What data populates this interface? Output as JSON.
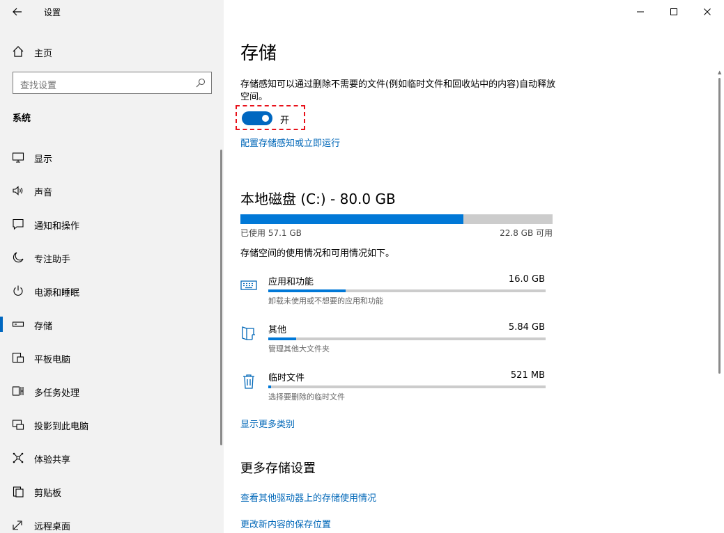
{
  "window": {
    "app_title": "设置"
  },
  "sidebar": {
    "home_label": "主页",
    "search_placeholder": "查找设置",
    "section_label": "系统",
    "items": [
      {
        "label": "显示",
        "icon": "monitor-icon"
      },
      {
        "label": "声音",
        "icon": "speaker-icon"
      },
      {
        "label": "通知和操作",
        "icon": "notification-icon"
      },
      {
        "label": "专注助手",
        "icon": "moon-icon"
      },
      {
        "label": "电源和睡眠",
        "icon": "power-icon"
      },
      {
        "label": "存储",
        "icon": "storage-icon",
        "active": true
      },
      {
        "label": "平板电脑",
        "icon": "tablet-icon"
      },
      {
        "label": "多任务处理",
        "icon": "multitask-icon"
      },
      {
        "label": "投影到此电脑",
        "icon": "project-icon"
      },
      {
        "label": "体验共享",
        "icon": "share-icon"
      },
      {
        "label": "剪贴板",
        "icon": "clipboard-icon"
      },
      {
        "label": "远程桌面",
        "icon": "remote-desktop-icon"
      }
    ]
  },
  "main": {
    "title": "存储",
    "description": "存储感知可以通过删除不需要的文件(例如临时文件和回收站中的内容)自动释放空间。",
    "storage_sense_toggle": {
      "state_label": "开",
      "on": true
    },
    "configure_link": "配置存储感知或立即运行",
    "disk": {
      "title": "本地磁盘 (C:) - 80.0 GB",
      "used_label": "已使用 57.1 GB",
      "free_label": "22.8 GB 可用",
      "used_fraction": 0.714
    },
    "usage_description": "存储空间的使用情况和可用情况如下。",
    "categories": [
      {
        "name": "应用和功能",
        "size": "16.0 GB",
        "sub": "卸载未使用或不想要的应用和功能",
        "fraction": 0.28,
        "icon": "keyboard-icon"
      },
      {
        "name": "其他",
        "size": "5.84 GB",
        "sub": "管理其他大文件夹",
        "fraction": 0.1,
        "icon": "folder-icon"
      },
      {
        "name": "临时文件",
        "size": "521 MB",
        "sub": "选择要删除的临时文件",
        "fraction": 0.01,
        "icon": "trash-icon"
      }
    ],
    "show_more_link": "显示更多类别",
    "more_settings_title": "更多存储设置",
    "more_links": [
      "查看其他驱动器上的存储使用情况",
      "更改新内容的保存位置"
    ]
  },
  "colors": {
    "accent": "#0067c0",
    "bar_fill": "#0078d7",
    "highlight_border": "#e8111a"
  }
}
